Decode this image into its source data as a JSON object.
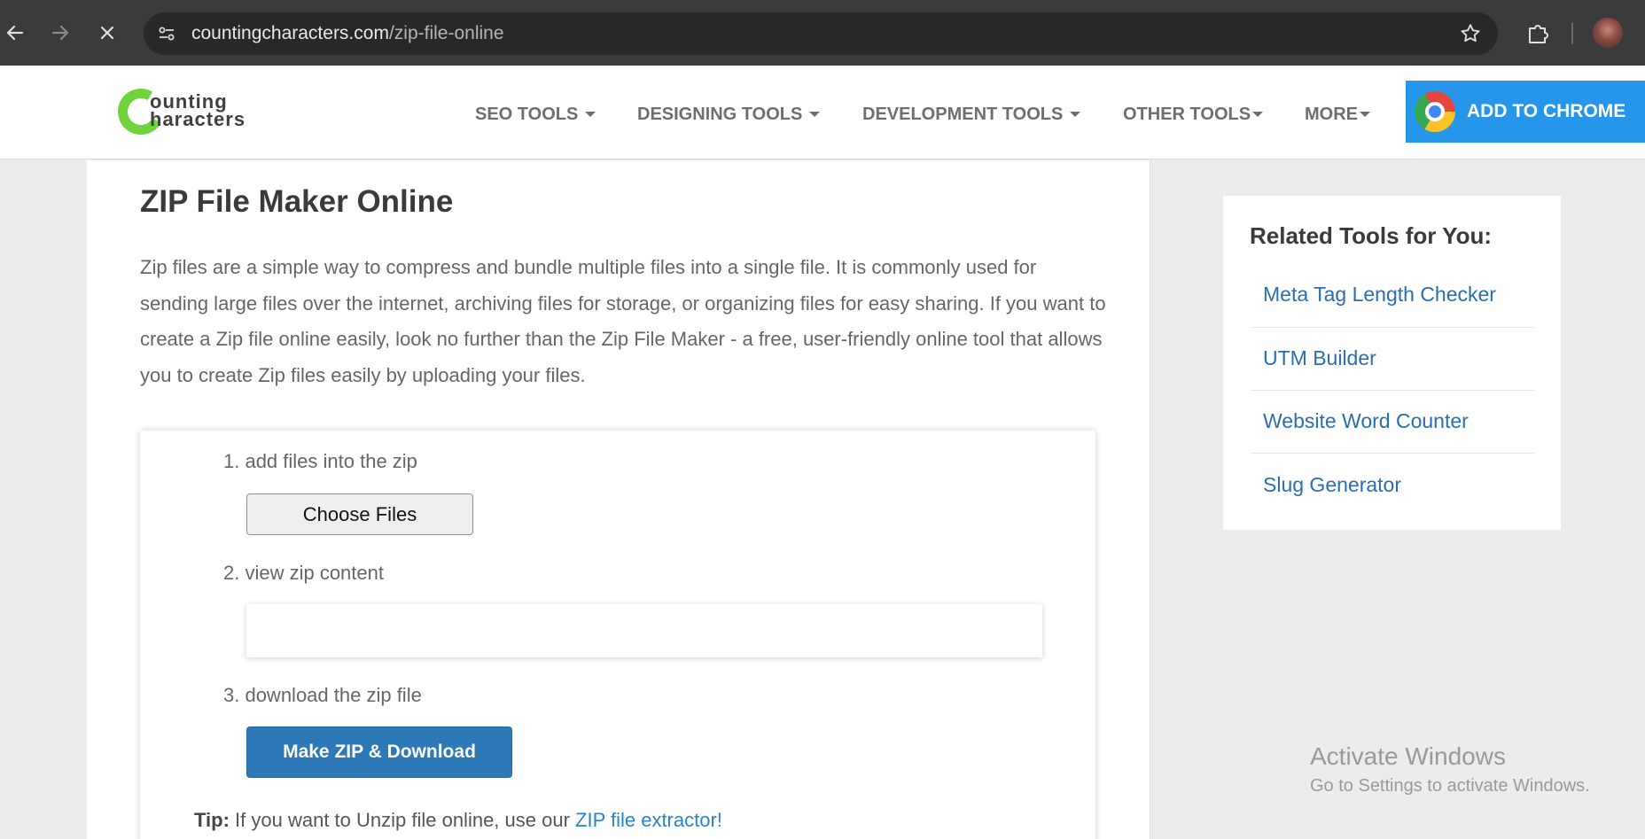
{
  "browser": {
    "url_domain": "countingcharacters.com",
    "url_path": "/zip-file-online"
  },
  "site": {
    "logo_line1": "ounting",
    "logo_line2": "haracters",
    "nav": [
      {
        "label": "SEO TOOLS"
      },
      {
        "label": "DESIGNING TOOLS"
      },
      {
        "label": "DEVELOPMENT TOOLS"
      },
      {
        "label": "OTHER TOOLS"
      },
      {
        "label": "MORE"
      }
    ],
    "add_to_chrome": "ADD TO CHROME"
  },
  "main": {
    "title": "ZIP File Maker Online",
    "intro": "Zip files are a simple way to compress and bundle multiple files into a single file. It is commonly used for sending large files over the internet, archiving files for storage, or organizing files for easy sharing. If you want to create a Zip file online easily, look no further than the Zip File Maker - a free, user-friendly online tool that allows you to create Zip files easily by uploading your files.",
    "steps": [
      {
        "label": "1. add files into the zip"
      },
      {
        "label": "2. view zip content"
      },
      {
        "label": "3. download the zip file"
      }
    ],
    "choose_files": "Choose Files",
    "make_zip": "Make ZIP & Download",
    "tip_label": "Tip:",
    "tip_text": " If you want to Unzip file online, use our ",
    "tip_link": "ZIP file extractor!"
  },
  "sidebar": {
    "title": "Related Tools for You:",
    "links": [
      {
        "label": "Meta Tag Length Checker"
      },
      {
        "label": "UTM Builder"
      },
      {
        "label": "Website Word Counter"
      },
      {
        "label": "Slug Generator"
      }
    ]
  },
  "watermark": {
    "line1": "Activate Windows",
    "line2": "Go to Settings to activate Windows."
  },
  "colors": {
    "brand_green": "#6fd33a",
    "chrome_button": "#2596ea",
    "primary_button": "#2d78b7",
    "link": "#2a6db0"
  }
}
